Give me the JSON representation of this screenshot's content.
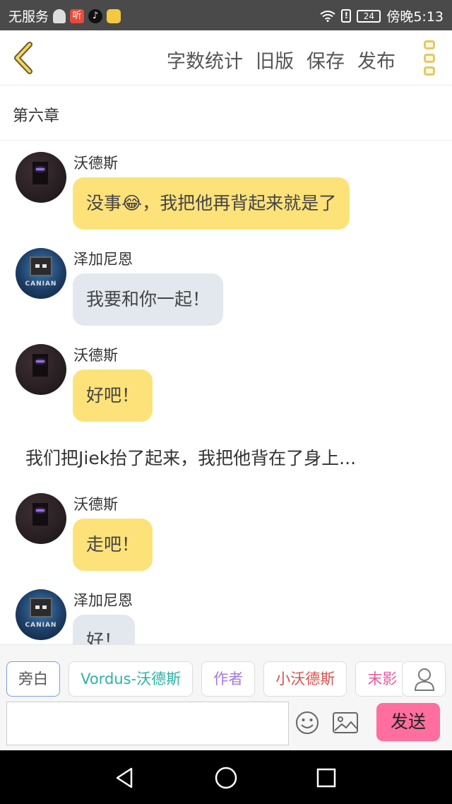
{
  "status_bar": {
    "carrier": "无服务",
    "ting_label": "听",
    "battery": "24",
    "time": "傍晚5:13"
  },
  "header": {
    "actions": [
      "字数统计",
      "旧版",
      "保存",
      "发布"
    ]
  },
  "chapter": {
    "title": "第六章"
  },
  "messages": [
    {
      "name": "沃德斯",
      "text": "没事😂，我把他再背起来就是了"
    },
    {
      "name": "泽加尼恩",
      "text": "我要和你一起！"
    },
    {
      "name": "沃德斯",
      "text": "好吧！"
    },
    {
      "name": "沃德斯",
      "text": "走吧！"
    },
    {
      "name": "泽加尼恩",
      "text": "好！"
    }
  ],
  "narration": "我们把Jiek抬了起来，我把他背在了身上...",
  "avatar_tags": {
    "zegarn": "CANIAN"
  },
  "roles": [
    {
      "label": "旁白",
      "color": "#555555"
    },
    {
      "label": "Vordus-沃德斯",
      "color": "#2bb3a6"
    },
    {
      "label": "作者",
      "color": "#a77ad8"
    },
    {
      "label": "小沃德斯",
      "color": "#d9534f"
    },
    {
      "label": "末影",
      "color": "#e85aa0"
    }
  ],
  "composer": {
    "input_value": "",
    "input_placeholder": "",
    "send_label": "发送"
  },
  "colors": {
    "bubble_yellow": "#fde27a",
    "bubble_grey": "#e3e8ef",
    "send_button": "#ff6e9f",
    "accent_gold": "#e2c96a"
  }
}
